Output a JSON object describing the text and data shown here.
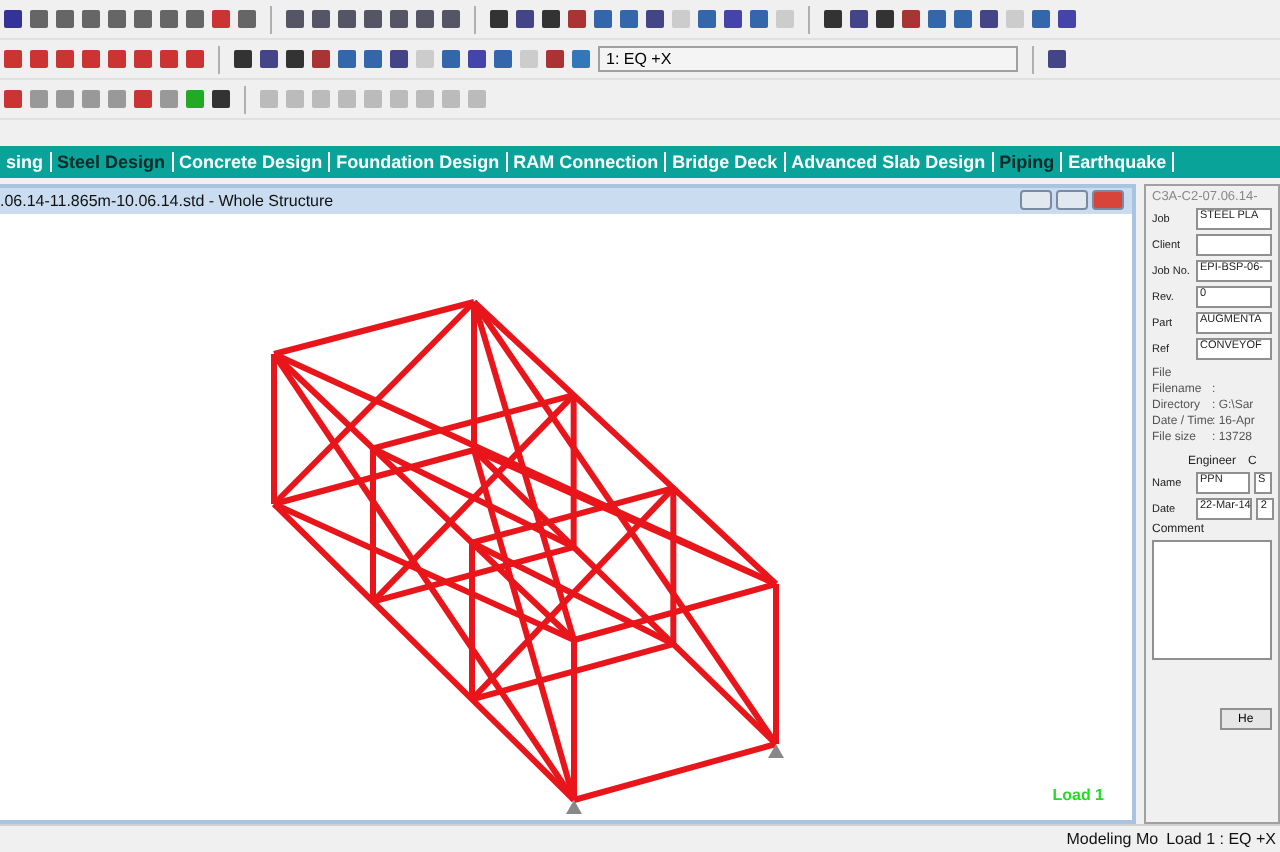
{
  "toolbar": {
    "load_case": "1: EQ +X"
  },
  "tabs": [
    {
      "label": "sing",
      "selected": false
    },
    {
      "label": "Steel Design",
      "selected": true
    },
    {
      "label": "Concrete Design",
      "selected": false
    },
    {
      "label": "Foundation Design",
      "selected": false
    },
    {
      "label": "RAM Connection",
      "selected": false
    },
    {
      "label": "Bridge Deck",
      "selected": false
    },
    {
      "label": "Advanced Slab Design",
      "selected": false
    },
    {
      "label": "Piping",
      "selected": true
    },
    {
      "label": "Earthquake",
      "selected": false
    }
  ],
  "viewport": {
    "title": ".06.14-11.865m-10.06.14.std - Whole Structure",
    "load_label": "Load 1"
  },
  "job_panel": {
    "title": "C3A-C2-07.06.14-",
    "fields": [
      {
        "label": "Job",
        "value": "STEEL PLA"
      },
      {
        "label": "Client"
      },
      {
        "label": "Job No.",
        "value": "EPI-BSP-06-"
      },
      {
        "label": "Rev.",
        "value": "0"
      },
      {
        "label": "Part",
        "value": "AUGMENTA"
      },
      {
        "label": "Ref",
        "value": "CONVEYOF"
      }
    ],
    "file_group": "File",
    "file_info": [
      {
        "label": "Filename",
        "value": ":"
      },
      {
        "label": "Directory",
        "value": ": G:\\Sar"
      },
      {
        "label": "Date / Time",
        "value": ": 16-Apr"
      },
      {
        "label": "File size",
        "value": ": 13728"
      }
    ],
    "columns": [
      "Engineer",
      "C"
    ],
    "rows": [
      {
        "label": "Name",
        "values": [
          "PPN",
          "S"
        ]
      },
      {
        "label": "Date",
        "values": [
          "22-Mar-14",
          "2"
        ]
      }
    ],
    "comment_label": "Comment",
    "help_button": "He"
  },
  "status_bar": [
    "Modeling Mo",
    "Load 1 : EQ +X"
  ]
}
